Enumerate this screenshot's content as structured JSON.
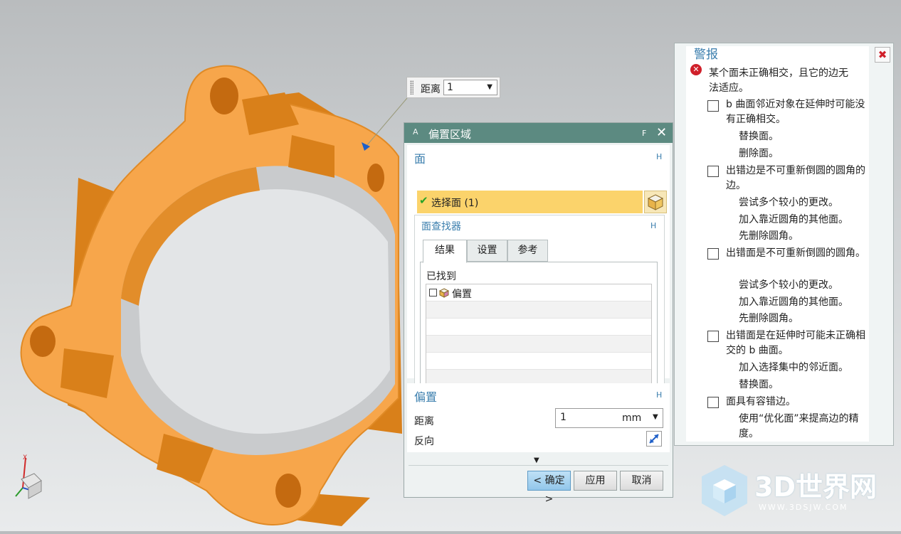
{
  "tooltip": {
    "label": "距离",
    "value": "1"
  },
  "dialog": {
    "title_left": "A",
    "title": "偏置区域",
    "title_right": "F",
    "close": "✕",
    "face_section": {
      "title": "面",
      "toggle": "H",
      "select_face": "选择面 (1)",
      "finder": {
        "title": "面查找器",
        "toggle": "H",
        "tabs": [
          "结果",
          "设置",
          "参考"
        ],
        "found_label": "已找到",
        "items": [
          "偏置"
        ]
      }
    },
    "offset_section": {
      "title": "偏置",
      "toggle": "H",
      "distance_label": "距离",
      "distance_value": "1",
      "distance_unit": "mm",
      "reverse_label": "反向"
    },
    "buttons": {
      "ok": "< 确定 >",
      "apply": "应用",
      "cancel": "取消"
    }
  },
  "alerts": {
    "title": "警报",
    "close": "✖",
    "error": "某个面未正确相交，且它的边无法适应。",
    "items": [
      {
        "text": "b 曲面邻近对象在延伸时可能没有正确相交。",
        "subs": [
          "替换面。",
          "删除面。"
        ]
      },
      {
        "text": "出错边是不可重新倒圆的圆角的边。",
        "subs": [
          "尝试多个较小的更改。",
          "加入靠近圆角的其他面。",
          "先删除圆角。"
        ]
      },
      {
        "text": "出错面是不可重新倒圆的圆角。",
        "subs": [
          "尝试多个较小的更改。",
          "加入靠近圆角的其他面。",
          "先删除圆角。"
        ]
      },
      {
        "text": "出错面是在延伸时可能未正确相交的 b 曲面。",
        "subs": [
          "加入选择集中的邻近面。",
          "替换面。"
        ]
      },
      {
        "text": "面具有容错边。",
        "subs": [
          "使用“优化面”来提高边的精度。"
        ]
      }
    ]
  },
  "triad": {
    "axis_label": "X"
  },
  "watermark": {
    "brand": "3D世界网",
    "url": "WWW.3DSJW.COM"
  },
  "colors": {
    "model": "#f7a64b",
    "model_shadow": "#d97d17",
    "title_bar": "#5c8a81",
    "accent": "#3c7fae",
    "highlight": "#fbd36b"
  }
}
